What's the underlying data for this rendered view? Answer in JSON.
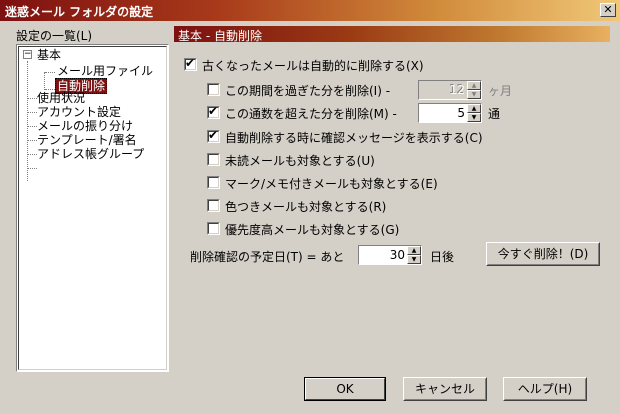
{
  "window": {
    "title": "迷惑メール フォルダの設定",
    "close_label": "✕"
  },
  "tree": {
    "label": "設定の一覧(L)",
    "items": [
      {
        "label": "基本",
        "expander": "−"
      },
      {
        "label": "メール用ファイル"
      },
      {
        "label": "自動削除"
      },
      {
        "label": "使用状況"
      },
      {
        "label": "アカウント設定"
      },
      {
        "label": "メールの振り分け"
      },
      {
        "label": "テンプレート/署名"
      },
      {
        "label": "アドレス帳グループ"
      }
    ]
  },
  "section": {
    "title": "基本 - 自動削除"
  },
  "options": {
    "auto_delete": {
      "label": "古くなったメールは自動的に削除する(X)",
      "checked": true
    },
    "period": {
      "label": "この期間を過ぎた分を削除(I) -",
      "checked": false,
      "value": "12",
      "unit": "ヶ月"
    },
    "count": {
      "label": "この通数を超えた分を削除(M) -",
      "checked": true,
      "value": "5",
      "unit": "通"
    },
    "confirm": {
      "label": "自動削除する時に確認メッセージを表示する(C)",
      "checked": true
    },
    "unread": {
      "label": "未読メールも対象とする(U)",
      "checked": false
    },
    "marked": {
      "label": "マーク/メモ付きメールも対象とする(E)",
      "checked": false
    },
    "colored": {
      "label": "色つきメールも対象とする(R)",
      "checked": false
    },
    "priority": {
      "label": "優先度高メールも対象とする(G)",
      "checked": false
    }
  },
  "schedule": {
    "label": "削除確認の予定日(T) = あと",
    "value": "30",
    "unit": "日後",
    "delete_now_label": "今すぐ削除！(D)"
  },
  "buttons": {
    "ok": "OK",
    "cancel": "キャンセル",
    "help": "ヘルプ(H)"
  },
  "icons": {
    "check": "✔",
    "spin_up": "▲",
    "spin_down": "▼"
  }
}
